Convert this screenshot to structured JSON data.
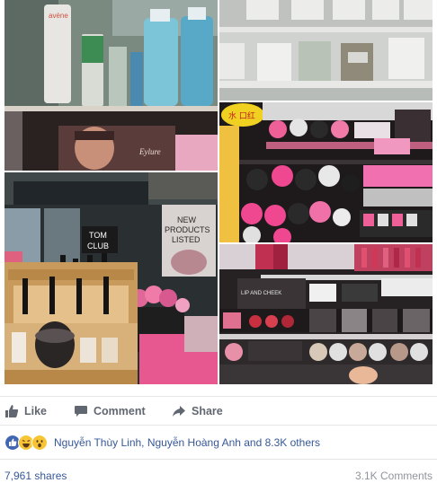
{
  "photos": {
    "p1": {
      "shelf_text": "Eylure"
    },
    "p3": {
      "sign_text": "水 口红"
    },
    "p4": {
      "sign_line1": "TOM",
      "sign_line2": "CLUB",
      "poster_line1": "NEW",
      "poster_line2": "PRODUCTS",
      "poster_line3": "LISTED"
    },
    "p5": {
      "box_text": "LIP AND CHEEK"
    }
  },
  "actions": {
    "like": "Like",
    "comment": "Comment",
    "share": "Share"
  },
  "reactions": {
    "icons": [
      "like-icon",
      "haha-icon",
      "wow-icon"
    ],
    "names": "Nguyễn Thùy Linh, Nguyễn Hoàng Anh and 8.3K others"
  },
  "stats": {
    "shares": "7,961 shares",
    "comments": "3.1K Comments"
  },
  "colors": {
    "link": "#365899",
    "muted": "#90949c",
    "action": "#616770",
    "like_blue": "#4267b2"
  }
}
